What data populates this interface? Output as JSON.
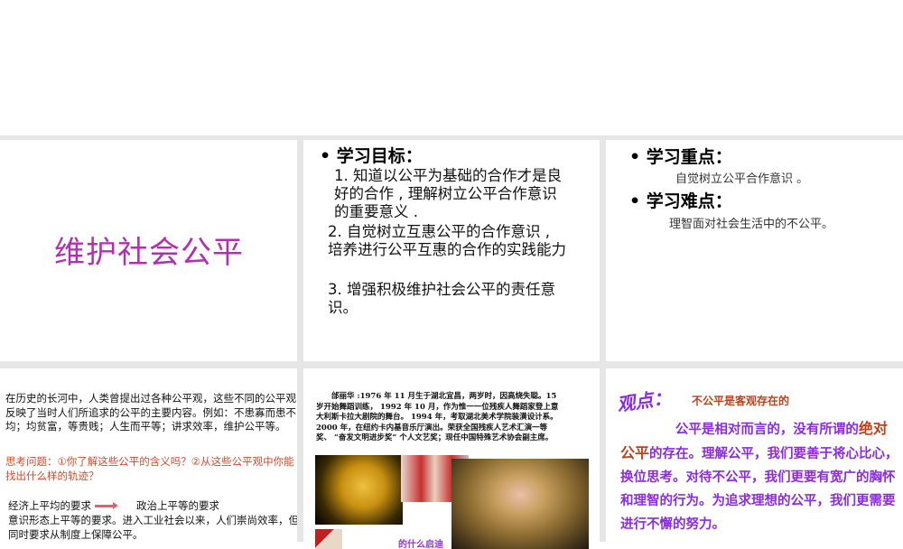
{
  "slide1": {
    "title": "维护社会公平"
  },
  "slide2": {
    "heading": "学习目标：",
    "items": [
      "1. 知道以公平为基础的合作才是良好的合作 , 理解树立公平合作意识的重要意义 .",
      "2. 自觉树立互惠公平的合作意识 , 培养进行公平互惠的合作的实践能力",
      "3. 增强积极维护社会公平的责任意识。"
    ]
  },
  "slide3": {
    "heading1": "学习重点：",
    "text1": "自觉树立公平合作意识 。",
    "heading2": "学习难点：",
    "text2": "理智面对社会生活中的不公平。"
  },
  "slide4": {
    "intro": "在历史的长河中，人类曾提出过各种公平观，这些不同的公平观反映了当时人们所追求的公平的主要内容。例如：不患寡而患不均；均贫富，等贵贱；人生而平等；讲求效率，维护公平等。",
    "question": "思考问题：①你了解这些公平的含义吗？②从这些公平观中你能找出什么样的轨迹？",
    "step1": "经济上平均的要求",
    "step2": "政治上平等的要求",
    "conclusion": "意识形态上平等的要求。进入工业社会以来，人们崇尚效率，但同时要求从制度上保障公平。"
  },
  "slide5": {
    "bio": "邰丽华 :1976 年 11 月生于湖北宜昌，两岁时，因高烧失聪。15 岁开始舞蹈训练， 1992 年 10 月，作为惟一一位残疾人舞蹈家登上意大利斯卡拉大剧院的舞台。 1994 年，考取湖北美术学院装潢设计系。 2000 年，在纽约卡内基音乐厅演出。荣获全国残疾人艺术汇演一等奖、 “奋发文明进步奖” 个人文艺奖；现任中国特殊艺术协会副主席。",
    "caption": "的什么启迪"
  },
  "slide6": {
    "label": "观点：",
    "claim": "不公平是客观存在的",
    "p_before": "公平是相对而言的，没有所谓的",
    "emph": "绝对公平",
    "p_after": "的存在。理解公平，我们要善于将心比心，换位思考。对待不公平，我们更要有宽广的胸怀和理智的行为。为追求理想的公平，我们更需要进行不懈的努力。"
  }
}
